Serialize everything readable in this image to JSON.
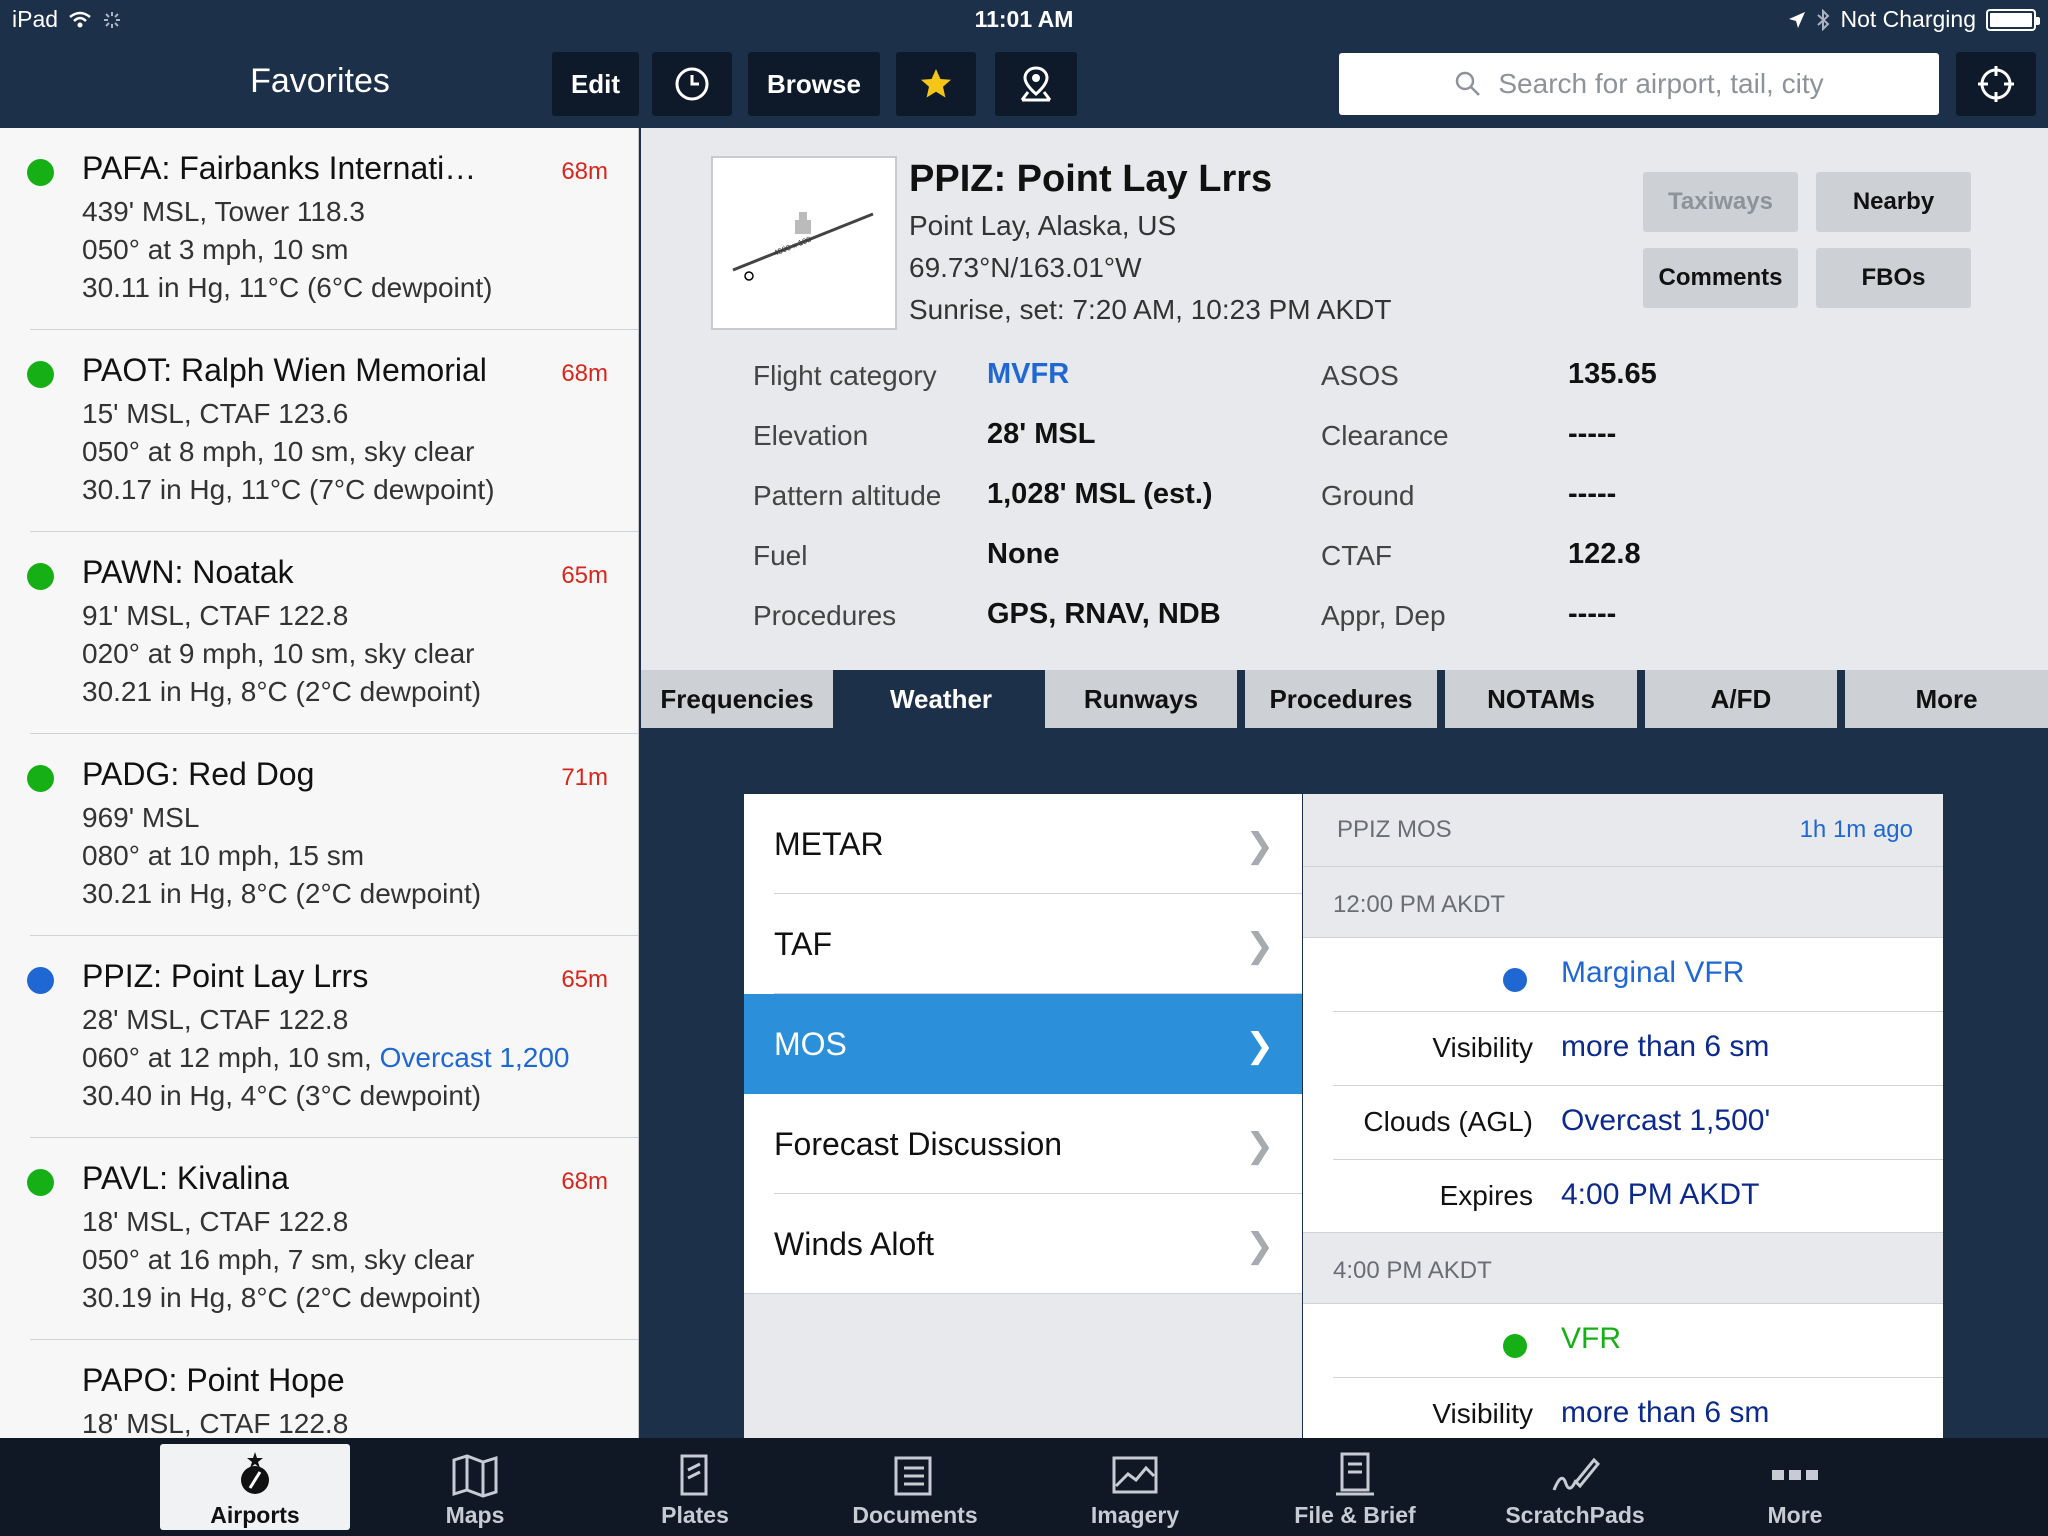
{
  "status": {
    "device": "iPad",
    "time": "11:01 AM",
    "charging": "Not Charging"
  },
  "nav": {
    "title": "Favorites",
    "edit": "Edit",
    "browse": "Browse",
    "search_placeholder": "Search for airport, tail, city"
  },
  "favorites": [
    {
      "name": "PAFA: Fairbanks Internati…",
      "dist": "68m",
      "status": "green",
      "l1": "439' MSL, Tower 118.3",
      "l2": "050° at 3 mph, 10 sm",
      "l3": "30.11 in Hg, 11°C (6°C dewpoint)"
    },
    {
      "name": "PAOT: Ralph Wien Memorial",
      "dist": "68m",
      "status": "green",
      "l1": "15' MSL, CTAF 123.6",
      "l2": "050° at 8 mph, 10 sm, sky clear",
      "l3": "30.17 in Hg, 11°C (7°C dewpoint)"
    },
    {
      "name": "PAWN: Noatak",
      "dist": "65m",
      "status": "green",
      "l1": "91' MSL, CTAF 122.8",
      "l2": "020° at 9 mph, 10 sm, sky clear",
      "l3": "30.21 in Hg, 8°C (2°C dewpoint)"
    },
    {
      "name": "PADG: Red Dog",
      "dist": "71m",
      "status": "green",
      "l1": "969' MSL",
      "l2": "080° at 10 mph, 15 sm",
      "l3": "30.21 in Hg, 8°C (2°C dewpoint)"
    },
    {
      "name": "PPIZ: Point Lay Lrrs",
      "dist": "65m",
      "status": "blue",
      "l1": "28' MSL, CTAF 122.8",
      "l2": "060° at 12 mph, 10 sm,",
      "l2b": "Overcast 1,200",
      "l3": "30.40 in Hg, 4°C (3°C dewpoint)"
    },
    {
      "name": "PAVL: Kivalina",
      "dist": "68m",
      "status": "green",
      "l1": "18' MSL, CTAF 122.8",
      "l2": "050° at 16 mph, 7 sm, sky clear",
      "l3": "30.19 in Hg, 8°C (2°C dewpoint)"
    },
    {
      "name": "PAPO: Point Hope",
      "dist": "",
      "status": "none",
      "l1": "18' MSL, CTAF 122.8",
      "l2": "",
      "l3": ""
    }
  ],
  "airport": {
    "title": "PPIZ: Point Lay Lrrs",
    "location": "Point Lay, Alaska, US",
    "coords": "69.73°N/163.01°W",
    "sun": "Sunrise, set: 7:20 AM, 10:23 PM AKDT",
    "diagram_label": "4500 x 100",
    "buttons": {
      "taxiways": "Taxiways",
      "nearby": "Nearby",
      "comments": "Comments",
      "fbos": "FBOs"
    },
    "info_left": [
      {
        "label": "Flight category",
        "value": "MVFR"
      },
      {
        "label": "Elevation",
        "value": "28' MSL"
      },
      {
        "label": "Pattern altitude",
        "value": "1,028' MSL (est.)"
      },
      {
        "label": "Fuel",
        "value": "None"
      },
      {
        "label": "Procedures",
        "value": "GPS, RNAV, NDB"
      }
    ],
    "info_right": [
      {
        "label": "ASOS",
        "value": "135.65"
      },
      {
        "label": "Clearance",
        "value": "-----"
      },
      {
        "label": "Ground",
        "value": "-----"
      },
      {
        "label": "CTAF",
        "value": "122.8"
      },
      {
        "label": "Appr, Dep",
        "value": "-----"
      }
    ]
  },
  "tabs": [
    "Frequencies",
    "Weather",
    "Runways",
    "Procedures",
    "NOTAMs",
    "A/FD",
    "More"
  ],
  "weather_menu": [
    "METAR",
    "TAF",
    "MOS",
    "Forecast Discussion",
    "Winds Aloft"
  ],
  "mos": {
    "title": "PPIZ MOS",
    "age": "1h 1m ago",
    "periods": [
      {
        "time": "12:00 PM AKDT",
        "category": "Marginal VFR",
        "visibility_label": "Visibility",
        "visibility": "more than 6 sm",
        "clouds_label": "Clouds (AGL)",
        "clouds": "Overcast 1,500'",
        "expires_label": "Expires",
        "expires": "4:00 PM AKDT"
      },
      {
        "time": "4:00 PM AKDT",
        "category": "VFR",
        "visibility_label": "Visibility",
        "visibility": "more than 6 sm"
      }
    ]
  },
  "colors": {
    "navy": "#1d3049",
    "vfr": "#16b016",
    "mvfr": "#1f67d2",
    "selection": "#2c8fd9",
    "distance": "#d9261c"
  },
  "tabbar": [
    "Airports",
    "Maps",
    "Plates",
    "Documents",
    "Imagery",
    "File & Brief",
    "ScratchPads",
    "More"
  ]
}
